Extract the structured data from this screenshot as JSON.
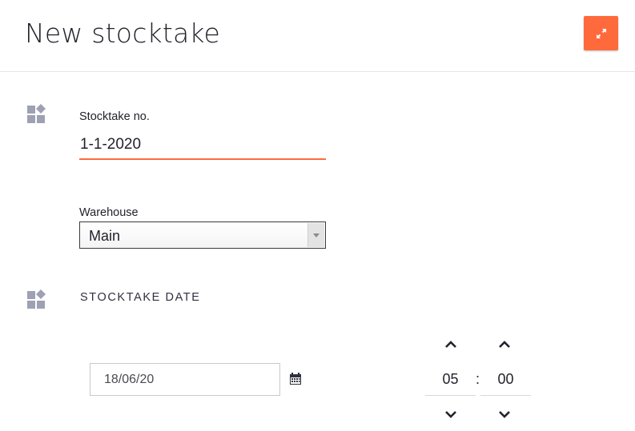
{
  "header": {
    "title": "New stocktake",
    "expand_icon": "expand-arrows-icon",
    "accent_color": "#ff6a3d"
  },
  "stocktake_no": {
    "label": "Stocktake no.",
    "value": "1-1-2020",
    "icon": "widgets-icon"
  },
  "warehouse": {
    "label": "Warehouse",
    "selected": "Main"
  },
  "stocktake_date": {
    "heading": "STOCKTAKE DATE",
    "icon": "widgets-icon",
    "date_value": "18/06/20",
    "calendar_icon": "calendar-icon",
    "hours": "05",
    "minutes": "00",
    "separator": ":"
  }
}
